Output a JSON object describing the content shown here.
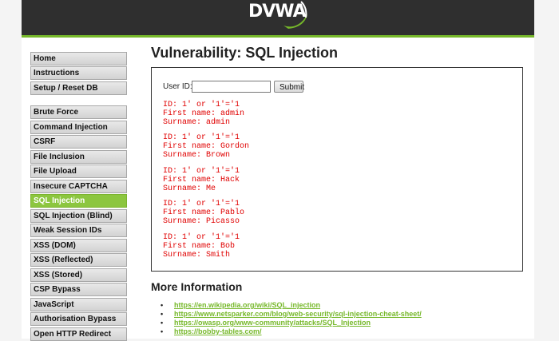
{
  "header": {
    "logo_text": "DVWA"
  },
  "menu": {
    "items": [
      {
        "label": "Home"
      },
      {
        "label": "Instructions"
      },
      {
        "label": "Setup / Reset DB"
      },
      {
        "label": "Brute Force"
      },
      {
        "label": "Command Injection"
      },
      {
        "label": "CSRF"
      },
      {
        "label": "File Inclusion"
      },
      {
        "label": "File Upload"
      },
      {
        "label": "Insecure CAPTCHA"
      },
      {
        "label": "SQL Injection",
        "selected": true
      },
      {
        "label": "SQL Injection (Blind)"
      },
      {
        "label": "Weak Session IDs"
      },
      {
        "label": "XSS (DOM)"
      },
      {
        "label": "XSS (Reflected)"
      },
      {
        "label": "XSS (Stored)"
      },
      {
        "label": "CSP Bypass"
      },
      {
        "label": "JavaScript"
      },
      {
        "label": "Authorisation Bypass"
      },
      {
        "label": "Open HTTP Redirect"
      }
    ]
  },
  "main": {
    "title": "Vulnerability: SQL Injection",
    "form": {
      "userid_label": "User ID:",
      "userid_value": "",
      "submit_label": "Submit"
    },
    "results": [
      {
        "id": "ID: 1' or '1'='1",
        "first": "First name: admin",
        "surname": "Surname: admin"
      },
      {
        "id": "ID: 1' or '1'='1",
        "first": "First name: Gordon",
        "surname": "Surname: Brown"
      },
      {
        "id": "ID: 1' or '1'='1",
        "first": "First name: Hack",
        "surname": "Surname: Me"
      },
      {
        "id": "ID: 1' or '1'='1",
        "first": "First name: Pablo",
        "surname": "Surname: Picasso"
      },
      {
        "id": "ID: 1' or '1'='1",
        "first": "First name: Bob",
        "surname": "Surname: Smith"
      }
    ],
    "more_info_title": "More Information",
    "links": [
      "https://en.wikipedia.org/wiki/SQL_injection",
      "https://www.netsparker.com/blog/web-security/sql-injection-cheat-sheet/",
      "https://owasp.org/www-community/attacks/SQL_Injection",
      "https://bobby-tables.com/"
    ]
  },
  "colors": {
    "accent": "#76b82a",
    "selected_menu": "#8cc63f",
    "header_bg": "#2f2f2f",
    "result_text": "#e00000"
  }
}
